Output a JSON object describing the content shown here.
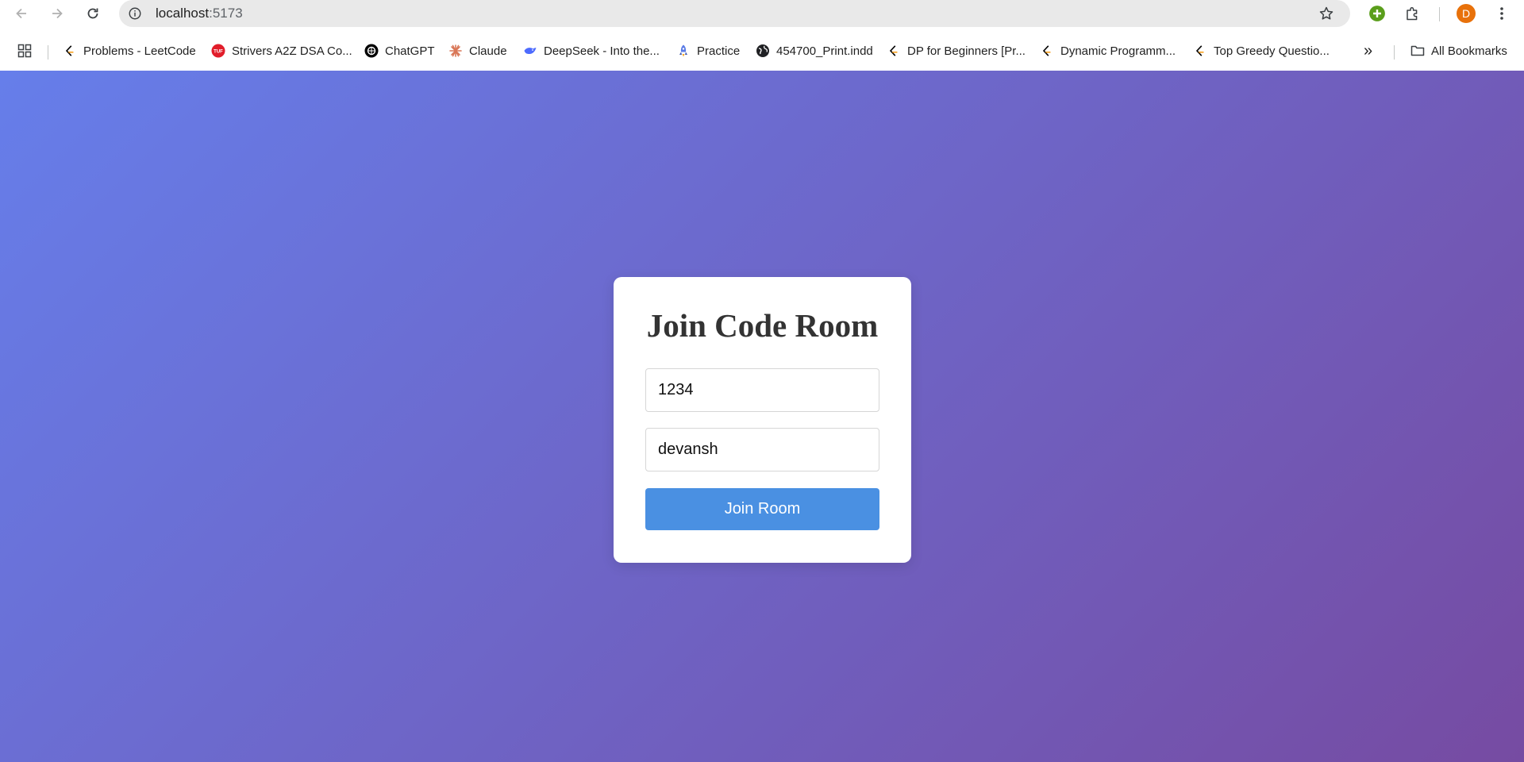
{
  "browser": {
    "url_host": "localhost",
    "url_port": ":5173",
    "profile_initial": "D"
  },
  "bookmarks": {
    "items": [
      {
        "label": "Problems - LeetCode",
        "icon": "leetcode-icon"
      },
      {
        "label": "Strivers A2Z DSA Co...",
        "icon": "tuf-icon"
      },
      {
        "label": "ChatGPT",
        "icon": "chatgpt-icon"
      },
      {
        "label": "Claude",
        "icon": "claude-icon"
      },
      {
        "label": "DeepSeek - Into the...",
        "icon": "deepseek-icon"
      },
      {
        "label": "Practice",
        "icon": "rocket-icon"
      },
      {
        "label": "454700_Print.indd",
        "icon": "globe-icon"
      },
      {
        "label": "DP for Beginners [Pr...",
        "icon": "leetcode-icon"
      },
      {
        "label": "Dynamic Programm...",
        "icon": "leetcode-icon"
      },
      {
        "label": "Top Greedy Questio...",
        "icon": "leetcode-icon"
      }
    ],
    "overflow_label": "»",
    "all_bookmarks_label": "All Bookmarks"
  },
  "join_form": {
    "title": "Join Code Room",
    "room_id_value": "1234",
    "username_value": "devansh",
    "submit_label": "Join Room"
  },
  "colors": {
    "gradient_start": "#667eea",
    "gradient_end": "#764ba2",
    "button": "#4a90e2",
    "title_text": "#333333"
  }
}
